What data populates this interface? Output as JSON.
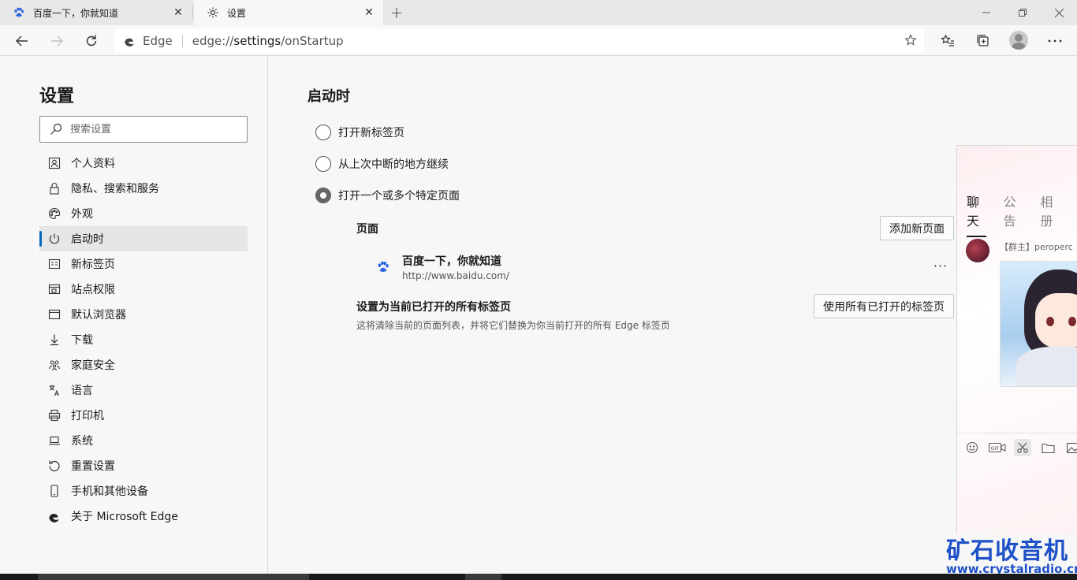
{
  "tabs": [
    {
      "title": "百度一下，你就知道",
      "icon": "baidu-icon"
    },
    {
      "title": "设置",
      "icon": "gear-icon"
    }
  ],
  "toolbar": {
    "site_badge": "Edge",
    "url_scheme": "edge://",
    "url_host": "settings",
    "url_path": "/onStartup"
  },
  "sidebar": {
    "title": "设置",
    "search_placeholder": "搜索设置",
    "items": [
      {
        "label": "个人资料",
        "icon": "profile-icon"
      },
      {
        "label": "隐私、搜索和服务",
        "icon": "lock-icon"
      },
      {
        "label": "外观",
        "icon": "palette-icon"
      },
      {
        "label": "启动时",
        "icon": "power-icon",
        "selected": true
      },
      {
        "label": "新标签页",
        "icon": "newtab-icon"
      },
      {
        "label": "站点权限",
        "icon": "site-permissions-icon"
      },
      {
        "label": "默认浏览器",
        "icon": "browser-icon"
      },
      {
        "label": "下载",
        "icon": "download-icon"
      },
      {
        "label": "家庭安全",
        "icon": "family-icon"
      },
      {
        "label": "语言",
        "icon": "language-icon"
      },
      {
        "label": "打印机",
        "icon": "printer-icon"
      },
      {
        "label": "系统",
        "icon": "laptop-icon"
      },
      {
        "label": "重置设置",
        "icon": "reset-icon"
      },
      {
        "label": "手机和其他设备",
        "icon": "phone-icon"
      },
      {
        "label": "关于 Microsoft Edge",
        "icon": "edge-logo-icon"
      }
    ]
  },
  "main": {
    "title": "启动时",
    "options": [
      {
        "label": "打开新标签页",
        "checked": false
      },
      {
        "label": "从上次中断的地方继续",
        "checked": false
      },
      {
        "label": "打开一个或多个特定页面",
        "checked": true
      }
    ],
    "pages_label": "页面",
    "add_page_button": "添加新页面",
    "page_entry": {
      "title": "百度一下，你就知道",
      "url": "http://www.baidu.com/"
    },
    "more_label": "···",
    "use_all_title": "设置为当前已打开的所有标签页",
    "use_all_desc": "这将清除当前的页面列表，并将它们替换为你当前打开的所有 Edge 标签页",
    "use_all_button": "使用所有已打开的标签页"
  },
  "chat": {
    "tabs": [
      "聊天",
      "公告",
      "相册"
    ],
    "sender": "【群主】peroperc"
  },
  "watermark": {
    "title": "矿石收音机",
    "url": "www.crystalradio.cn"
  }
}
